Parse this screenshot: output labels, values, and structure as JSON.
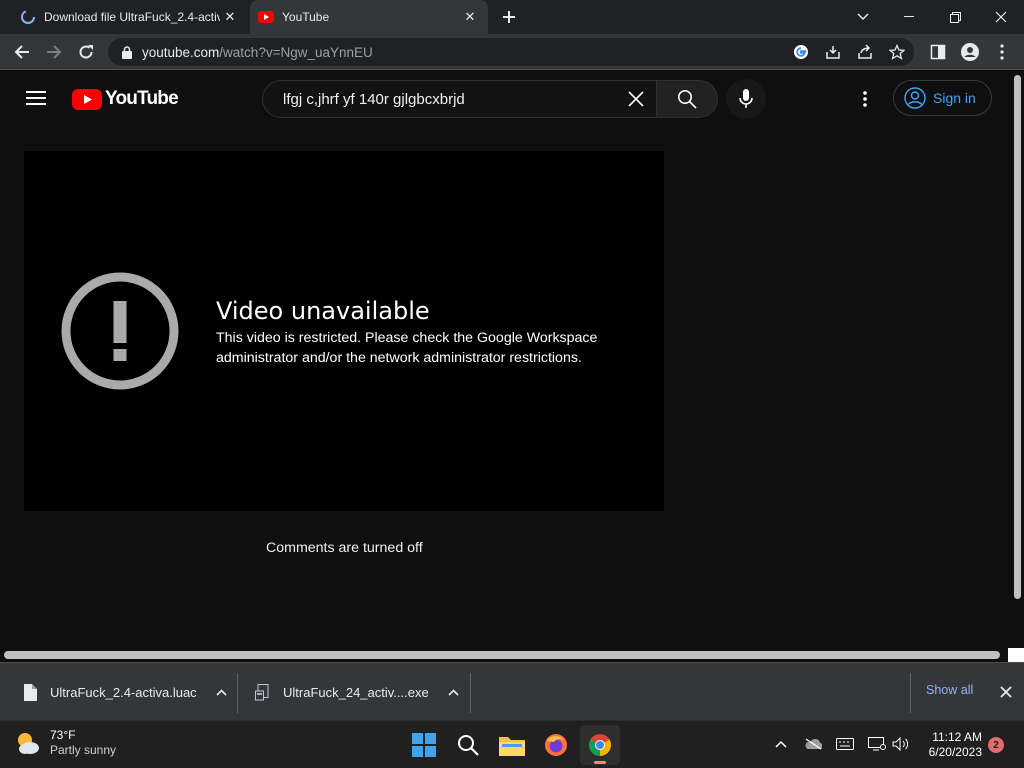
{
  "browser": {
    "tabs": [
      {
        "title": "Download file UltraFuck_2.4-activ",
        "active": false
      },
      {
        "title": "YouTube",
        "active": true
      }
    ],
    "url_host": "youtube.com",
    "url_path": "/watch?v=Ngw_uaYnnEU"
  },
  "youtube": {
    "logo_text": "YouTube",
    "search_query": "lfgj c,jhrf yf 140r gjlgbcxbrjd",
    "signin_label": "Sign in",
    "accent_color": "#3ea6ff",
    "brand_red": "#ff0000"
  },
  "player": {
    "error_title": "Video unavailable",
    "error_message": "This video is restricted. Please check the Google Workspace administrator and/or the network administrator restrictions."
  },
  "comments_status": "Comments are turned off",
  "downloads": {
    "items": [
      {
        "filename": "UltraFuck_2.4-activa.luac",
        "icon": "file-icon"
      },
      {
        "filename": "UltraFuck_24_activ....exe",
        "icon": "installer-icon"
      }
    ],
    "show_all_label": "Show all"
  },
  "taskbar": {
    "weather_temp": "73°F",
    "weather_condition": "Partly sunny",
    "time": "11:12 AM",
    "date": "6/20/2023",
    "notification_count": "2"
  }
}
